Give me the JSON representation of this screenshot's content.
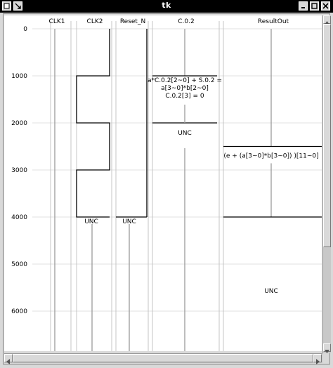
{
  "window": {
    "title": "tk"
  },
  "columns": [
    {
      "id": "clk1",
      "label": "CLK1"
    },
    {
      "id": "clk2",
      "label": "CLK2"
    },
    {
      "id": "reset_n",
      "label": "Reset_N"
    },
    {
      "id": "c02",
      "label": "C.0.2"
    },
    {
      "id": "resultout",
      "label": "ResultOut"
    }
  ],
  "time_axis": {
    "ticks": [
      0,
      1000,
      2000,
      3000,
      4000,
      5000,
      6000
    ]
  },
  "signals": {
    "clk2": {
      "edges": [
        1000,
        2000,
        3000,
        4000
      ],
      "after": "UNC"
    },
    "reset_n": {
      "edges": [
        4000
      ],
      "after": "UNC"
    },
    "c02": {
      "expr_lines": [
        "a*C.0.2[2~0] + S.0.2 =",
        "a[3~0]*b[2~0]",
        "C.0.2[3] = 0"
      ],
      "start": 1000,
      "end": 2000,
      "after": "UNC"
    },
    "resultout": {
      "expr": "(e + (a[3~0]*b[3~0]) )[11~0]",
      "start": 2500,
      "end": 4000,
      "after": "UNC"
    }
  },
  "colors": {
    "grid": "#e2e2e2",
    "signal": "#000000",
    "lane": "#9a9a9a"
  }
}
